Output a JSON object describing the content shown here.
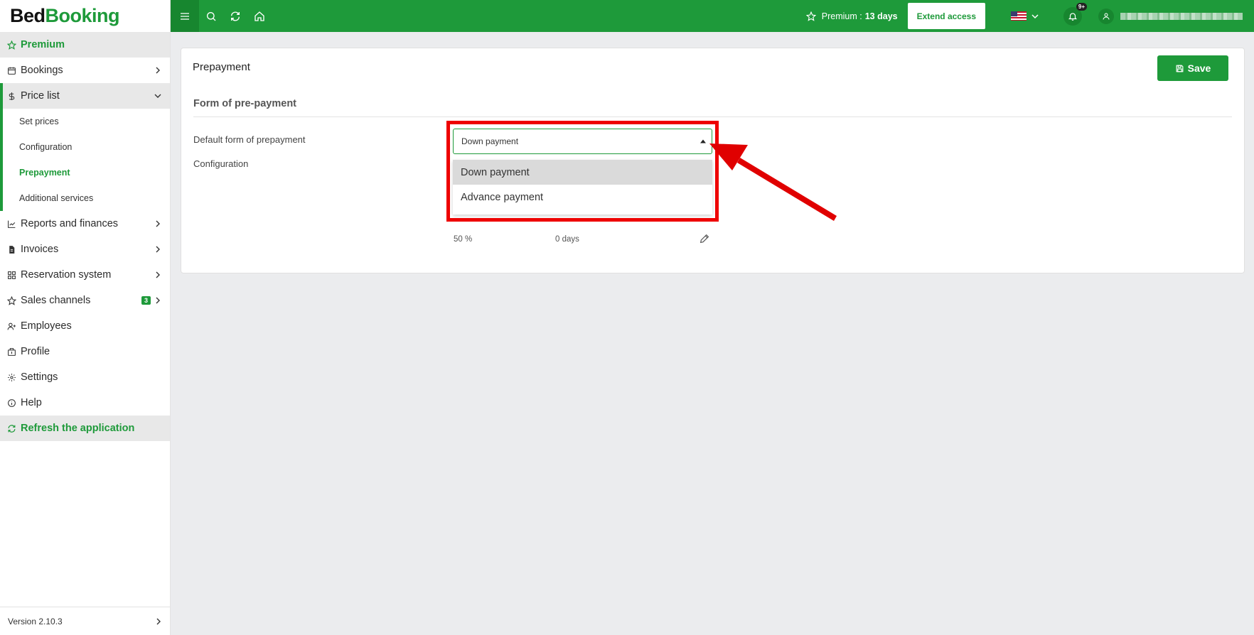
{
  "logo": {
    "part1": "Bed",
    "part2": "Booking"
  },
  "sidebar": {
    "premium_label": "Premium",
    "items": [
      {
        "label": "Bookings",
        "icon": "calendar-icon"
      },
      {
        "label": "Price list",
        "icon": "dollar-icon"
      },
      {
        "label": "Reports and finances",
        "icon": "chart-icon"
      },
      {
        "label": "Invoices",
        "icon": "invoice-icon"
      },
      {
        "label": "Reservation system",
        "icon": "grid-icon"
      },
      {
        "label": "Sales channels",
        "icon": "star-icon",
        "badge": "3"
      },
      {
        "label": "Employees",
        "icon": "user-plus-icon"
      },
      {
        "label": "Profile",
        "icon": "building-icon"
      },
      {
        "label": "Settings",
        "icon": "gear-icon"
      },
      {
        "label": "Help",
        "icon": "info-icon"
      }
    ],
    "price_list_sub": [
      "Set prices",
      "Configuration",
      "Prepayment",
      "Additional services"
    ],
    "refresh_label": "Refresh the application",
    "version": "Version 2.10.3"
  },
  "topbar": {
    "premium_text": "Premium :",
    "premium_days": "13 days",
    "extend_label": "Extend access",
    "notifications_count": "9+"
  },
  "main": {
    "title": "Prepayment",
    "save_label": "Save",
    "section_title": "Form of pre-payment",
    "default_form_label": "Default form of prepayment",
    "configuration_label": "Configuration",
    "select_value": "Down payment",
    "options": [
      "Down payment",
      "Advance payment"
    ],
    "row": {
      "percent": "50 %",
      "days": "0 days"
    }
  },
  "colors": {
    "brand": "#1e9a3a",
    "annotation": "#e00000"
  }
}
